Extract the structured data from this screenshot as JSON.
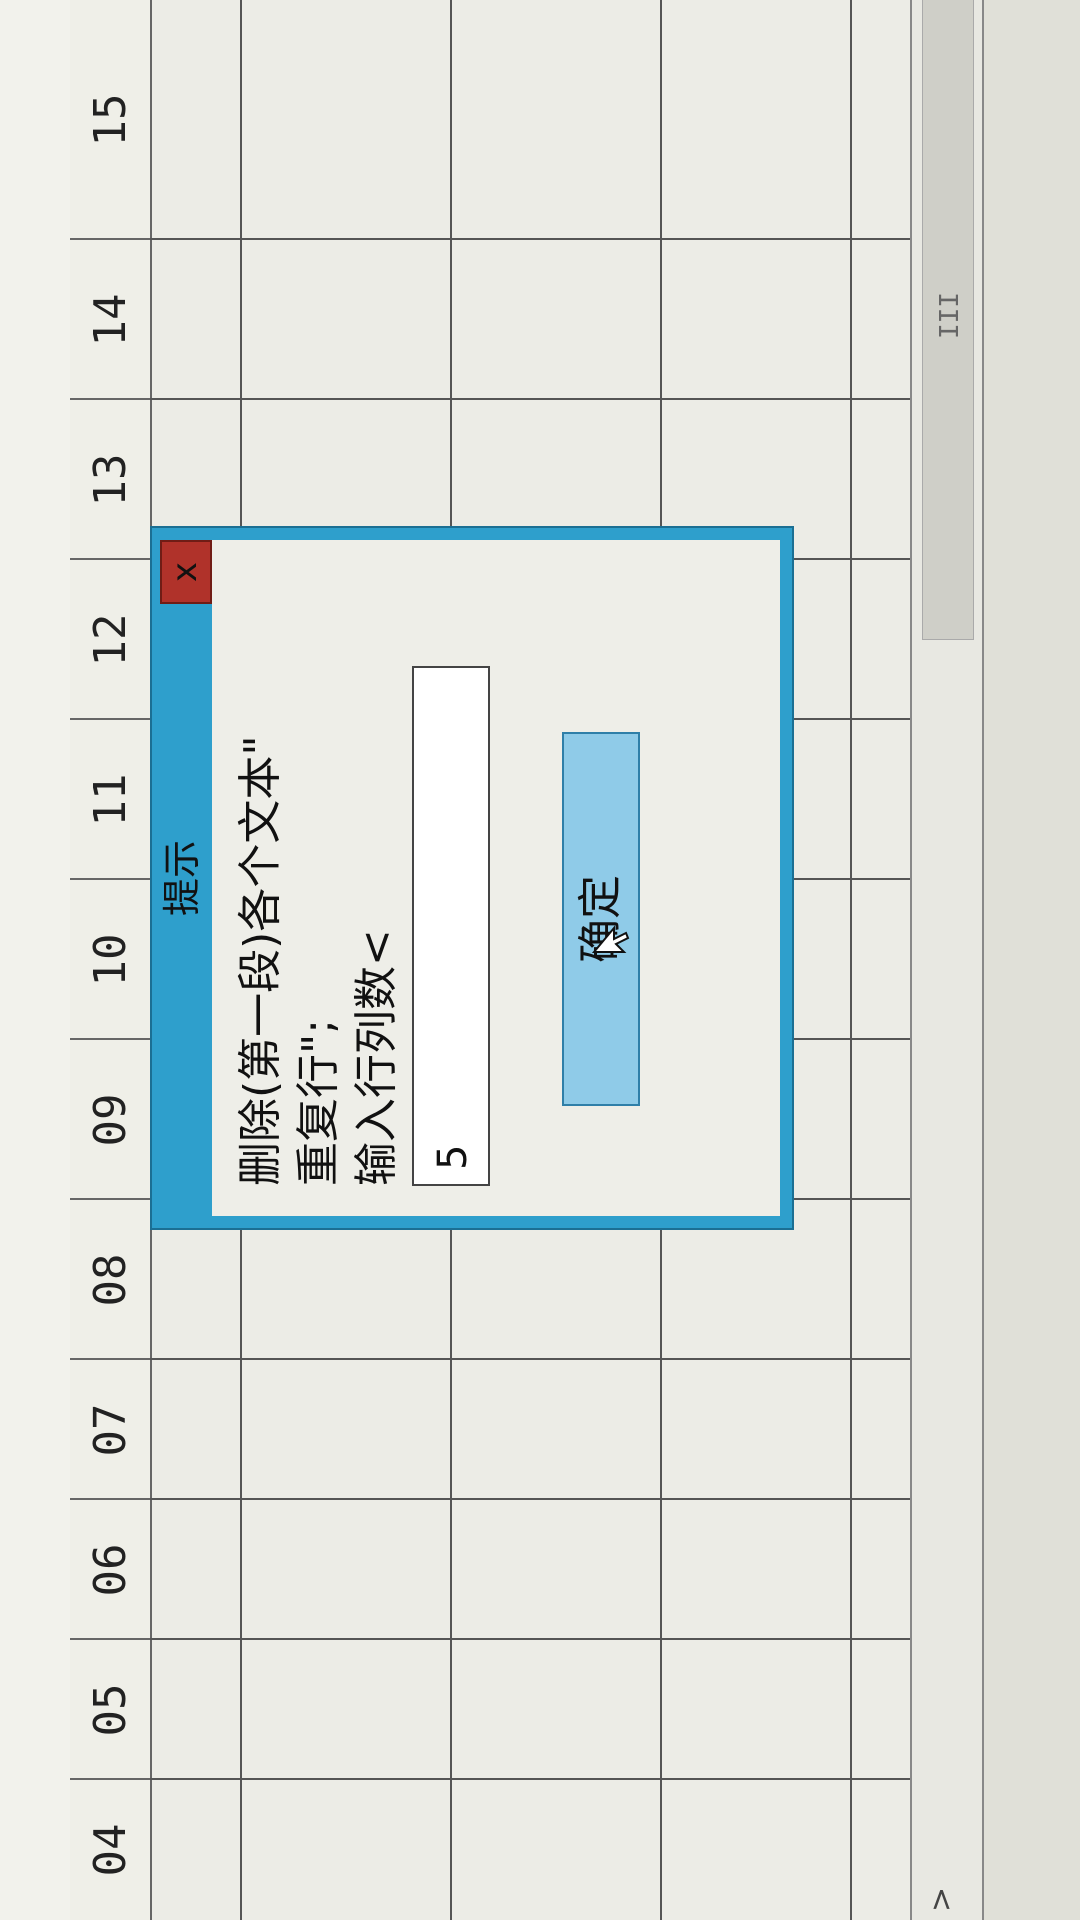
{
  "sheet": {
    "column_headers": [
      "04",
      "05",
      "06",
      "07",
      "08",
      "09",
      "10",
      "11",
      "12",
      "13",
      "14",
      "15"
    ]
  },
  "scroll": {
    "grip": "III",
    "arrow": ">"
  },
  "dialog": {
    "title": "提示",
    "close_label": "x",
    "message_lines": [
      "删除(第一段)各个文本\"",
      "重复行\";",
      "输入行列数<"
    ],
    "input_value": "5",
    "ok_label": "确定"
  },
  "colors": {
    "dialog_frame": "#2e9fcc",
    "close_button": "#b0322a",
    "ok_button": "#8fcbe8"
  }
}
